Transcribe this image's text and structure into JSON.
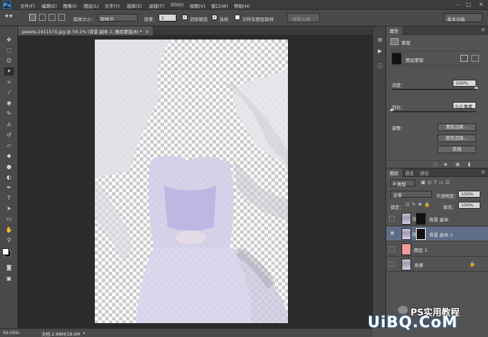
{
  "app": {
    "logo": "Ps"
  },
  "menu": [
    "文件(F)",
    "编辑(E)",
    "图像(I)",
    "图层(L)",
    "文字(Y)",
    "选择(S)",
    "滤镜(T)",
    "3D(D)",
    "视图(V)",
    "窗口(W)",
    "帮助(H)"
  ],
  "window_controls": {
    "minimize": "–",
    "maximize": "□",
    "close": "✕"
  },
  "options": {
    "sample_size_label": "取样大小：",
    "sample_size_value": "取样点",
    "tolerance_label": "容差：",
    "tolerance_value": "1",
    "antialias_label": "消除锯齿",
    "contiguous_label": "连续",
    "all_layers_label": "对所有图层取样",
    "refine_edge_label": "调整边缘…",
    "workspace": "基本功能"
  },
  "document": {
    "tab_title": "pexels-2411574.jpg @ 59.1% (背景 副本 2, 图层蒙版/8) *",
    "close": "×"
  },
  "status": {
    "zoom": "59.05%",
    "doc": "文档:2.98M/18.6M"
  },
  "properties": {
    "tab": "属性",
    "section": "蒙版",
    "mask_label": "图层蒙版",
    "density_label": "浓度：",
    "density_value": "100%",
    "density_level": 1.0,
    "feather_label": "羽化：",
    "feather_value": "0.0 像素",
    "feather_level": 0.0,
    "refine_label": "调整：",
    "btn_mask_edge": "蒙版边缘…",
    "btn_color_range": "颜色范围…",
    "btn_invert": "反相"
  },
  "layers_panel": {
    "tabs": [
      "图层",
      "通道",
      "路径"
    ],
    "filter": "P 类型",
    "blend_mode": "正常",
    "opacity_label": "不透明度：",
    "opacity_value": "100%",
    "lock_label": "锁定：",
    "fill_label": "填充：",
    "fill_value": "100%",
    "layers": [
      {
        "name": "背景 副本",
        "visible": false,
        "selected": false,
        "type": "masked"
      },
      {
        "name": "背景 副本 2",
        "visible": true,
        "selected": true,
        "type": "masked"
      },
      {
        "name": "图层 1",
        "visible": false,
        "selected": false,
        "type": "fill"
      },
      {
        "name": "背景",
        "visible": false,
        "selected": false,
        "type": "background"
      }
    ]
  },
  "watermark": {
    "line1": "PS实用教程",
    "line2": "UiBQ.CoM"
  },
  "colors": {
    "accent": "#56b2ff",
    "selected_layer": "#5e6e86",
    "fill_layer": "#f09a9a"
  }
}
